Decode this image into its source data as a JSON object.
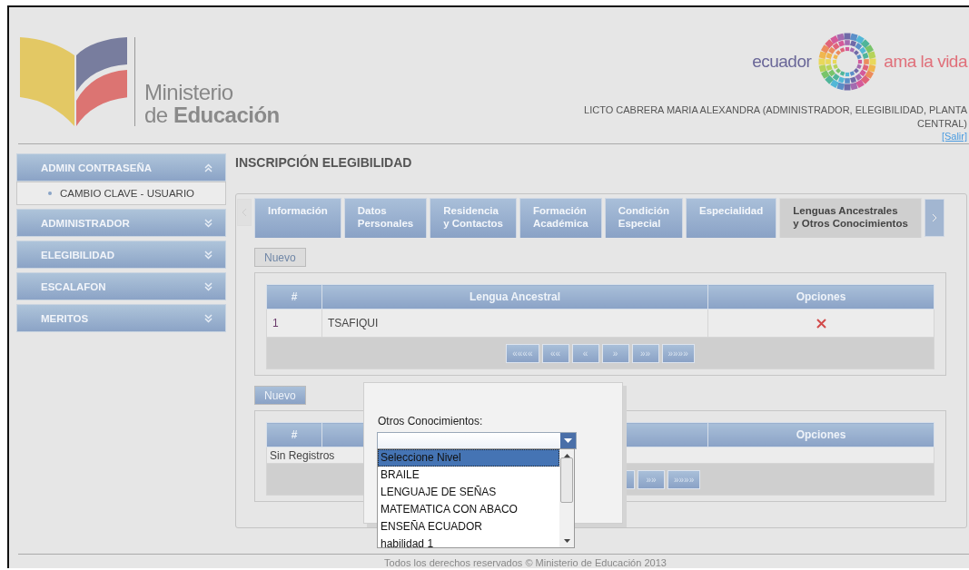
{
  "header": {
    "logo_line1": "Ministerio",
    "logo_line2": "de **Educación**",
    "brand_left": "ecuador",
    "brand_right": "ama la vida",
    "user": "LICTO CABRERA MARIA ALEXANDRA (ADMINISTRADOR, ELEGIBILIDAD, PLANTA CENTRAL)",
    "logout": "[Salir]"
  },
  "sidebar": [
    {
      "label": "ADMIN CONTRASEÑA",
      "expanded": true,
      "items": [
        "CAMBIO CLAVE - USUARIO"
      ]
    },
    {
      "label": "ADMINISTRADOR",
      "expanded": false
    },
    {
      "label": "ELEGIBILIDAD",
      "expanded": false
    },
    {
      "label": "ESCALAFON",
      "expanded": false
    },
    {
      "label": "MERITOS",
      "expanded": false
    }
  ],
  "page_title": "INSCRIPCIÓN ELEGIBILIDAD",
  "tabs": [
    {
      "label": "Información",
      "selected": false
    },
    {
      "label": "Datos\nPersonales",
      "selected": false
    },
    {
      "label": "Residencia\ny Contactos",
      "selected": false
    },
    {
      "label": "Formación\nAcadémica",
      "selected": false
    },
    {
      "label": "Condición\nEspecial",
      "selected": false
    },
    {
      "label": "Especialidad",
      "selected": false
    },
    {
      "label": "Lenguas Ancestrales\ny Otros Conocimientos",
      "selected": true
    }
  ],
  "languages": {
    "new_button": {
      "label": "Nuevo",
      "disabled": true
    },
    "columns": [
      "#",
      "Lengua Ancestral",
      "Opciones"
    ],
    "rows": [
      {
        "index": "1",
        "language": "TSAFIQUI"
      }
    ],
    "pager": [
      "««««",
      "««",
      "«",
      "»",
      "»»",
      "»»»»"
    ]
  },
  "knowledge": {
    "new_button": {
      "label": "Nuevo",
      "disabled": false
    },
    "columns": [
      "#",
      "Opciones"
    ],
    "empty_text": "Sin Registros",
    "pager": [
      "»»",
      "»»»»"
    ]
  },
  "dialog": {
    "label": "Otros Conocimientos:",
    "options": [
      {
        "label": "Seleccione Nivel",
        "selected": true
      },
      {
        "label": "BRAILE",
        "selected": false
      },
      {
        "label": "LENGUAJE DE SEÑAS",
        "selected": false
      },
      {
        "label": "MATEMATICA CON ABACO",
        "selected": false
      },
      {
        "label": "ENSEÑA ECUADOR",
        "selected": false
      },
      {
        "label": "habilidad 1",
        "selected": false
      }
    ]
  },
  "footer": "Todos los derechos reservados © Ministerio de Educación 2013"
}
